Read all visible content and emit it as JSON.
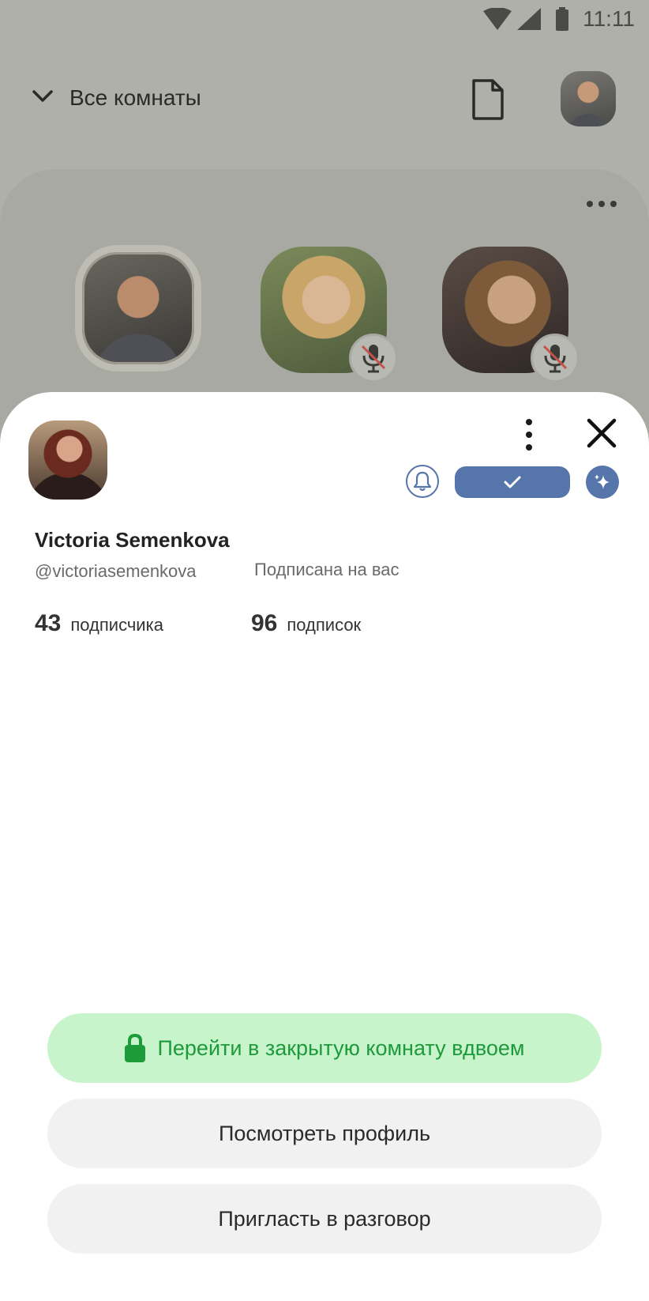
{
  "status_bar": {
    "time": "11:11"
  },
  "header": {
    "rooms_title": "Все комнаты"
  },
  "profile": {
    "name": "Victoria Semenkova",
    "handle": "@victoriasemenkova",
    "follows_you": "Подписана на вас",
    "followers_count": "43",
    "followers_label": "подписчика",
    "following_count": "96",
    "following_label": "подписок"
  },
  "actions": {
    "private_room": "Перейти в закрытую комнату вдвоем",
    "view_profile": "Посмотреть профиль",
    "invite": "Пригласть в разговор"
  },
  "colors": {
    "accent": "#5675aa",
    "private_bg": "#c7f4cb",
    "private_text": "#1d9a3a",
    "dim_overlay": "#b0b0aa"
  },
  "icons": [
    "wifi-icon",
    "signal-icon",
    "battery-icon",
    "chevron-down-icon",
    "document-icon",
    "more-horizontal-icon",
    "mic-off-icon",
    "more-vertical-icon",
    "close-icon",
    "bell-icon",
    "check-icon",
    "sparkle-icon",
    "lock-icon"
  ]
}
